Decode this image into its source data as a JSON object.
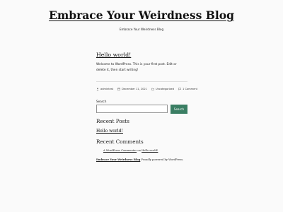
{
  "site": {
    "title": "Embrace Your Weirdness Blog",
    "tagline": "Embrace Your Weirdness Blog"
  },
  "post": {
    "title": "Hello world!",
    "excerpt": "Welcome to WordPress. This is your first post. Edit or delete it, then start writing!",
    "meta": {
      "author": "admintest",
      "date": "December 11, 2021",
      "category": "Uncategorized",
      "comments": "1 Comment"
    }
  },
  "search": {
    "label": "Search",
    "value": "",
    "placeholder": "",
    "button_label": "Search"
  },
  "recent_posts": {
    "heading": "Recent Posts",
    "items": [
      {
        "label": "Hello world!"
      }
    ]
  },
  "recent_comments": {
    "heading": "Recent Comments",
    "items": [
      {
        "author": "A WordPress Commenter",
        "connector": "on",
        "post": "Hello world!"
      }
    ]
  },
  "footer": {
    "site_link": "Embrace Your Weirdness Blog",
    "powered_by": "Proudly powered by WordPress."
  },
  "colors": {
    "background": "#fafafa",
    "accent": "#3a7e63",
    "text": "#111111"
  },
  "icons": {
    "author": "person-icon",
    "date": "calendar-icon",
    "category": "folder-icon",
    "comments": "comment-icon"
  }
}
